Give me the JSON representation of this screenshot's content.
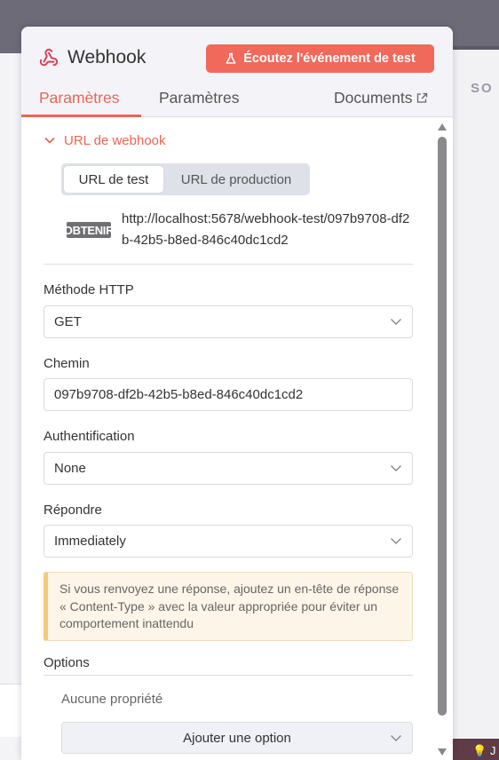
{
  "background": {
    "right_label": "SO",
    "bottom_right_text": "J"
  },
  "header": {
    "title": "Webhook",
    "listen_button": "Écoutez l'événement de test",
    "tabs": [
      "Paramètres",
      "Paramètres"
    ],
    "docs_tab": "Documents"
  },
  "webhook_url": {
    "section_label": "URL de webhook",
    "toggle_test": "URL de test",
    "toggle_production": "URL de production",
    "method_badge": "OBTENIR",
    "url": "http://localhost:5678/webhook-test/097b9708-df2b-42b5-b8ed-846c40dc1cd2"
  },
  "fields": {
    "http_method": {
      "label": "Méthode HTTP",
      "value": "GET"
    },
    "path": {
      "label": "Chemin",
      "value": "097b9708-df2b-42b5-b8ed-846c40dc1cd2"
    },
    "authentication": {
      "label": "Authentification",
      "value": "None"
    },
    "respond": {
      "label": "Répondre",
      "value": "Immediately"
    }
  },
  "notice": "Si vous renvoyez une réponse, ajoutez un en-tête de réponse « Content-Type » avec la valeur appropriée pour éviter un comportement inattendu",
  "options": {
    "title": "Options",
    "empty_text": "Aucune propriété",
    "add_button": "Ajouter une option"
  },
  "colors": {
    "accent": "#ea6654",
    "button": "#f1695a"
  }
}
